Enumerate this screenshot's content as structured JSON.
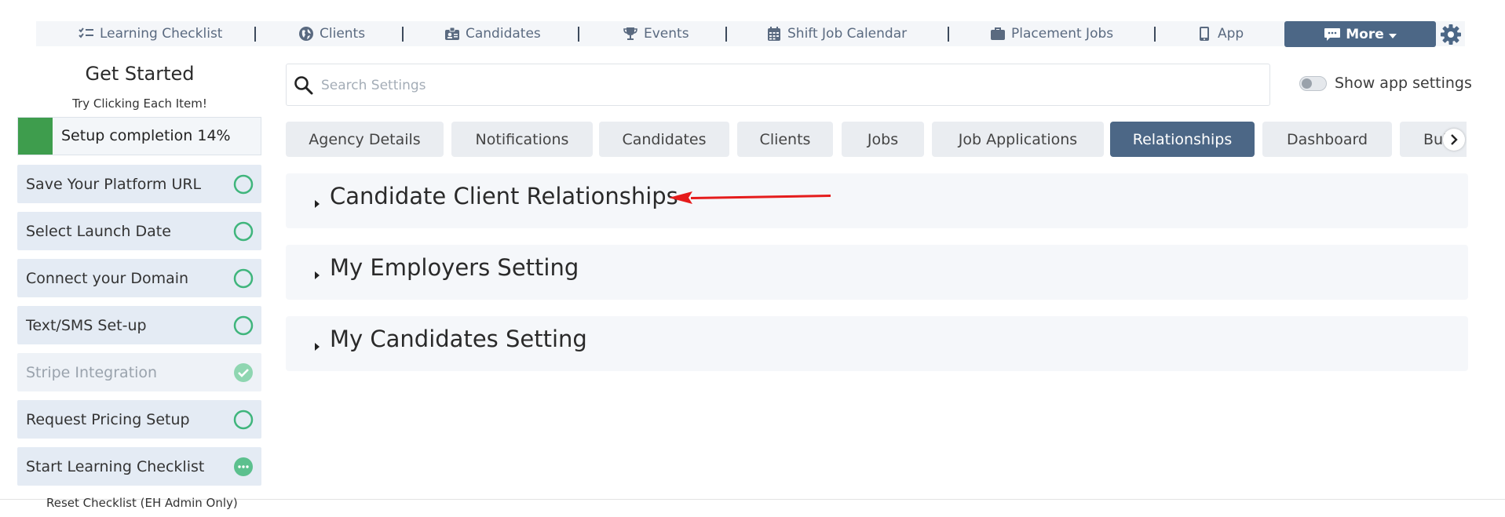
{
  "nav": {
    "items": [
      {
        "label": "Learning Checklist",
        "icon": "checklist-icon"
      },
      {
        "label": "Clients",
        "icon": "globe-icon"
      },
      {
        "label": "Candidates",
        "icon": "id-badge-icon"
      },
      {
        "label": "Events",
        "icon": "trophy-icon"
      },
      {
        "label": "Shift Job Calendar",
        "icon": "calendar-icon"
      },
      {
        "label": "Placement Jobs",
        "icon": "briefcase-icon"
      },
      {
        "label": "App",
        "icon": "phone-icon"
      }
    ],
    "more_label": "More",
    "more_icon": "chat-icon",
    "settings_icon": "gear-icon"
  },
  "sidebar": {
    "title": "Get Started",
    "subtitle": "Try Clicking Each Item!",
    "progress_label": "Setup completion 14%",
    "progress_percent": 14,
    "items": [
      {
        "label": "Save Your Platform URL",
        "state": "pending"
      },
      {
        "label": "Select Launch Date",
        "state": "pending"
      },
      {
        "label": "Connect your Domain",
        "state": "pending"
      },
      {
        "label": "Text/SMS Set-up",
        "state": "pending"
      },
      {
        "label": "Stripe Integration",
        "state": "done"
      },
      {
        "label": "Request Pricing Setup",
        "state": "pending"
      },
      {
        "label": "Start Learning Checklist",
        "state": "in-progress"
      }
    ],
    "reset_label": "Reset Checklist (EH Admin Only)"
  },
  "search": {
    "placeholder": "Search Settings",
    "value": ""
  },
  "app_settings_toggle": {
    "label": "Show app settings",
    "checked": false
  },
  "tabs": [
    {
      "label": "Agency Details"
    },
    {
      "label": "Notifications"
    },
    {
      "label": "Candidates"
    },
    {
      "label": "Clients"
    },
    {
      "label": "Jobs"
    },
    {
      "label": "Job Applications"
    },
    {
      "label": "Relationships",
      "active": true
    },
    {
      "label": "Dashboard"
    },
    {
      "label": "Bui"
    }
  ],
  "sections": [
    {
      "title": "Candidate Client Relationships"
    },
    {
      "title": "My Employers Setting"
    },
    {
      "title": "My Candidates Setting"
    }
  ],
  "colors": {
    "accent": "#4c6786",
    "progress": "#3e9d4d",
    "check": "#4dbf8a",
    "annotation_arrow": "#e51c1c"
  }
}
